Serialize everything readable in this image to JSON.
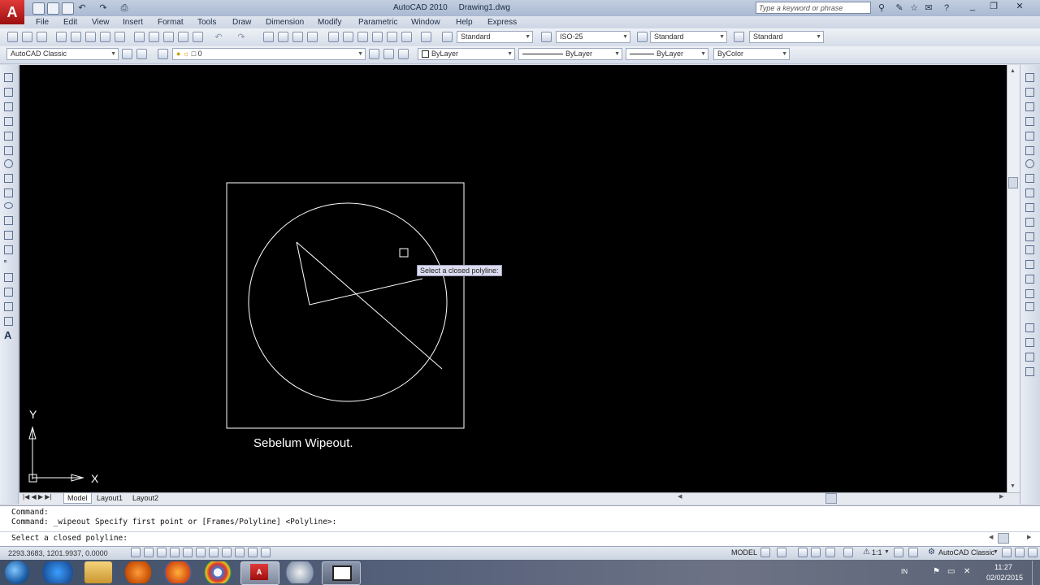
{
  "title_bar": {
    "app_name": "AutoCAD 2010",
    "file_name": "Drawing1.dwg",
    "search_placeholder": "Type a keyword or phrase"
  },
  "menu": [
    "File",
    "Edit",
    "View",
    "Insert",
    "Format",
    "Tools",
    "Draw",
    "Dimension",
    "Modify",
    "Parametric",
    "Window",
    "Help",
    "Express"
  ],
  "toolbar_styles": {
    "text_style": "Standard",
    "dim_style": "ISO-25",
    "table_style": "Standard",
    "multileader_style": "Standard"
  },
  "workspace": "AutoCAD Classic",
  "layer": "0",
  "properties": {
    "color": "ByLayer",
    "linetype": "ByLayer",
    "lineweight": "ByLayer",
    "plot_style": "ByColor"
  },
  "drawing": {
    "tooltip": "Select a closed polyline:",
    "caption": "Sebelum Wipeout.",
    "ucs_y": "Y",
    "ucs_x": "X"
  },
  "layout_tabs": [
    "Model",
    "Layout1",
    "Layout2"
  ],
  "command_history": [
    "Command:",
    "Command: _wipeout Specify first point or [Frames/Polyline] <Polyline>:"
  ],
  "command_prompt": "Select a closed polyline:",
  "status_bar": {
    "coordinates": "2293.3683, 1201.9937, 0.0000",
    "space": "MODEL",
    "annotation_scale": "1:1",
    "workspace": "AutoCAD Classic"
  },
  "taskbar": {
    "language": "IN",
    "time": "11:27",
    "date": "02/02/2015"
  },
  "colors": {
    "canvas": "#000000",
    "drawing_lines": "#ffffff",
    "tooltip_bg": "#dcdcf0"
  }
}
